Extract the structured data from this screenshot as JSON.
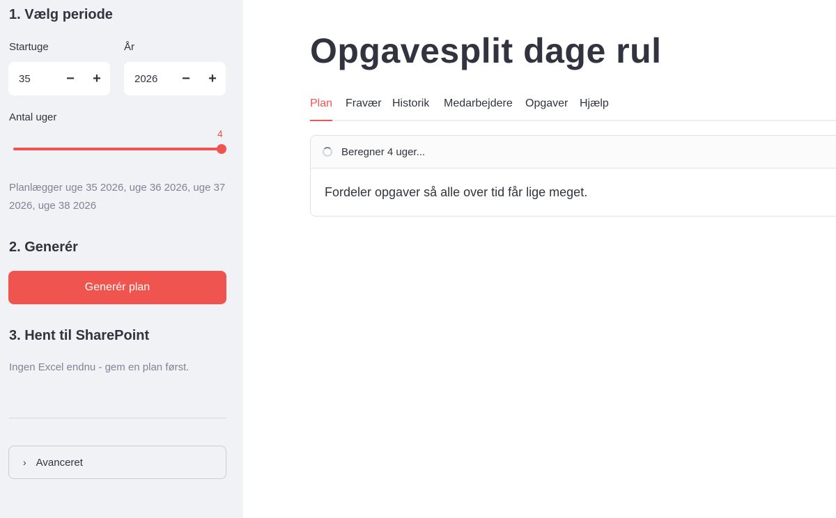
{
  "sidebar": {
    "section1_title": "1. Vælg periode",
    "start_week": {
      "label": "Startuge",
      "value": "35",
      "minus": "−",
      "plus": "+"
    },
    "year": {
      "label": "År",
      "value": "2026",
      "minus": "−",
      "plus": "+"
    },
    "weeks": {
      "label": "Antal uger",
      "value": "4"
    },
    "plan_note": "Planlægger uge 35 2026, uge 36 2026, uge 37 2026, uge 38 2026",
    "section2_title": "2. Generér",
    "generate_button": "Generér plan",
    "section3_title": "3. Hent til SharePoint",
    "no_excel_note": "Ingen Excel endnu - gem en plan først.",
    "advanced_label": "Avanceret"
  },
  "main": {
    "title": "Opgavesplit dage rul",
    "tabs": [
      "Plan",
      "Fravær",
      "Historik",
      "Medarbejdere",
      "Opgaver",
      "Hjælp"
    ],
    "active_tab": "Plan",
    "status": {
      "header": "Beregner 4 uger...",
      "message": "Fordeler opgaver så alle over tid får lige meget."
    }
  },
  "colors": {
    "accent": "#f0544f",
    "sidebar_bg": "#f0f2f6",
    "text": "#31333f",
    "muted": "#808495"
  }
}
